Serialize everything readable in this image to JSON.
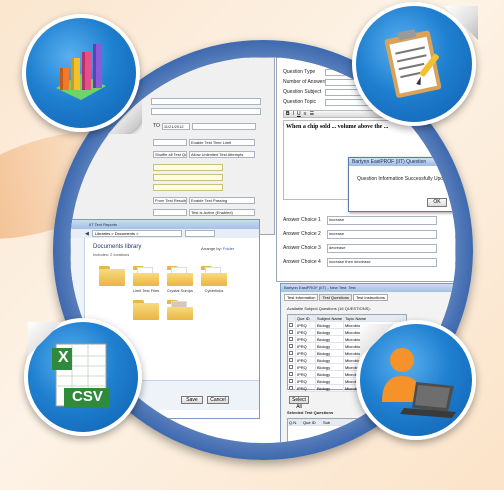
{
  "colors": {
    "background": "#fbe6cf",
    "ring": "#2f5ea8",
    "badge": "#1f80d0",
    "folder": "#f2c65a",
    "excel_green": "#2f8a3c"
  },
  "left_form": {
    "date_label": "TO",
    "date_value": "11/21/2012",
    "select_1": "Enable Test Time Limit",
    "select_2": "Allow Unlimited Test Attempts",
    "select_3": "Shuffle all Test Questions",
    "select_4": "From Test Results To User",
    "select_5": "Enable Test Passing",
    "select_6": "Test Is Active (Enabled)"
  },
  "question_form": {
    "labels": [
      "Question Type",
      "Number of Answers",
      "Question Subject",
      "Question Topic"
    ],
    "question_text": "When a chip sold ... volume above the ...",
    "answer_labels": [
      "Answer Choice 1",
      "Answer Choice 2",
      "Answer Choice 3",
      "Answer Choice 4"
    ],
    "answer_values": [
      "increase",
      "increase",
      "decrease",
      "increase then decrease"
    ]
  },
  "info_dialog": {
    "title": "Bartynn EasiPROF (IIT) Question",
    "message": "Question Information Successfully Update",
    "ok": "OK"
  },
  "explorer": {
    "title": "IIT Text Reports",
    "path": "Libraries > Documents >",
    "library_title": "Documents library",
    "library_sub": "Includes: 2 locations",
    "arrange_label": "Arrange by:",
    "arrange_value": "Folder",
    "folders": [
      "",
      "Limit Test Files",
      "Crystal Sumps",
      "Cyberlinks",
      "",
      ""
    ],
    "save": "Save",
    "cancel": "Cancel"
  },
  "test_window": {
    "title": "Bartynn EasiPROF (IIT) - New Test: Test",
    "tabs": [
      "Test Information",
      "Test Questions",
      "Test Instructions"
    ],
    "available_label": "Available Subject Questions (16 QUESTIONS):",
    "columns": [
      "Que ID",
      "Subject Name",
      "Topic Name"
    ],
    "rows": [
      [
        "IPRQ",
        "Biology",
        "Microbiology"
      ],
      [
        "IPRQ",
        "Biology",
        "Microbiology"
      ],
      [
        "IPRQ",
        "Biology",
        "Microbiology"
      ],
      [
        "IPRQ",
        "Biology",
        "Microbiology"
      ],
      [
        "IPRQ",
        "Biology",
        "Microbiology"
      ],
      [
        "IPRQ",
        "Biology",
        "Microbiology"
      ],
      [
        "IPRQ",
        "Biology",
        "Microbiology"
      ],
      [
        "IPRQ",
        "Biology",
        "Microbiology"
      ],
      [
        "IPRQ",
        "Biology",
        "Microbiology"
      ],
      [
        "IPRQ",
        "Biology",
        "Microbiology"
      ]
    ],
    "select_all": "Select All",
    "selected_label": "Selected Test Questions",
    "selected_columns": [
      "Q.N.",
      "Que ID",
      "Sub"
    ]
  },
  "badges": {
    "csv_label": "CSV",
    "excel_letter": "X",
    "icons": [
      "chart-icon",
      "clipboard-icon",
      "csv-file-icon",
      "user-computer-icon"
    ]
  }
}
